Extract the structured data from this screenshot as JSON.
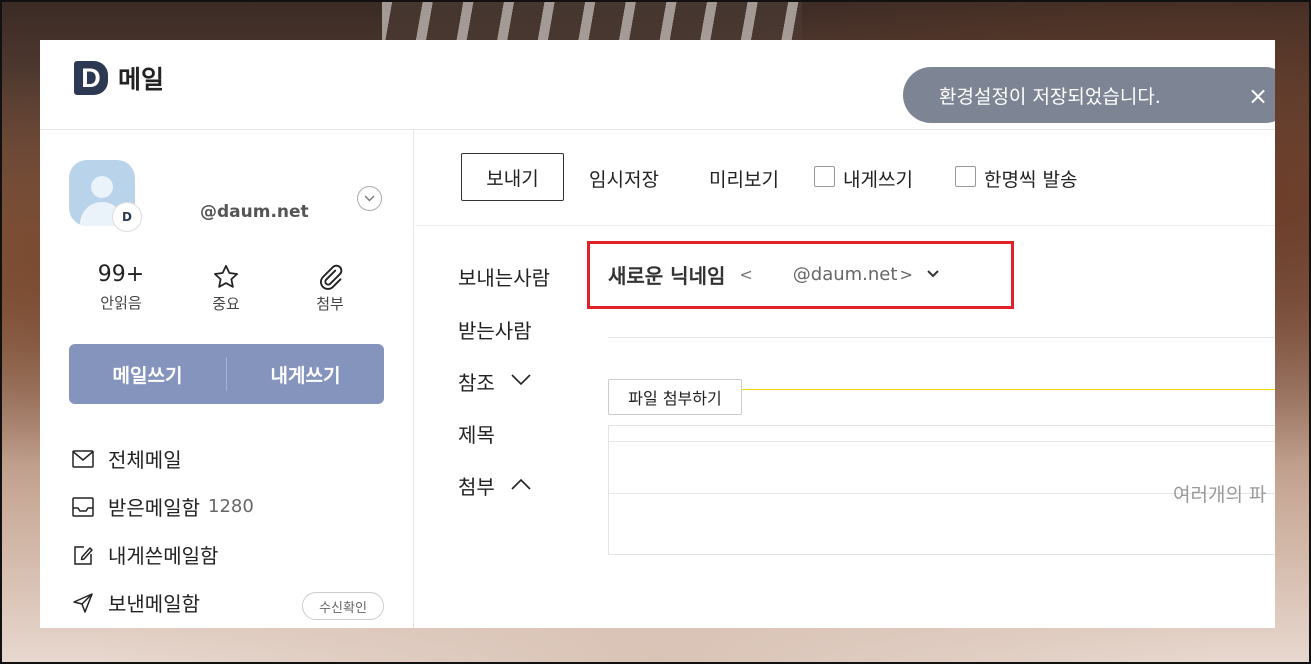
{
  "header": {
    "logo_letter": "D",
    "logo_text": "메일"
  },
  "toast": {
    "message": "환경설정이 저장되었습니다.",
    "close_glyph": "×"
  },
  "profile": {
    "avatar_badge": "D",
    "email": "@daum.net"
  },
  "stats": [
    {
      "value": "99+",
      "label": "안읽음"
    },
    {
      "icon": "star-icon",
      "label": "중요"
    },
    {
      "icon": "paperclip-icon",
      "label": "첨부"
    }
  ],
  "write_buttons": {
    "compose": "메일쓰기",
    "to_me": "내게쓰기"
  },
  "sidebar": {
    "items": [
      {
        "label": "전체메일",
        "icon": "envelope-icon"
      },
      {
        "label": "받은메일함",
        "count": "1280",
        "icon": "inbox-icon"
      },
      {
        "label": "내게쓴메일함",
        "icon": "edit-note-icon"
      },
      {
        "label": "보낸메일함",
        "icon": "send-icon",
        "badge": "수신확인"
      }
    ]
  },
  "toolbar": {
    "send": "보내기",
    "save_draft": "임시저장",
    "preview": "미리보기",
    "to_me": "내게쓰기",
    "individual_send": "한명씩 발송"
  },
  "compose": {
    "sender_label": "보내는사람",
    "recipient_label": "받는사람",
    "cc_label": "참조",
    "subject_label": "제목",
    "attachment_label": "첨부",
    "sender_nickname": "새로운 닉네임",
    "sender_open": "<",
    "sender_email": "@daum.net",
    "sender_close": ">",
    "attach_button": "파일 첨부하기",
    "dropzone_hint": "여러개의 파"
  },
  "colors": {
    "accent_button": "#8494bd",
    "highlight_box": "#e1202a",
    "active_underline": "#f2d900",
    "logo": "#2d3952"
  }
}
